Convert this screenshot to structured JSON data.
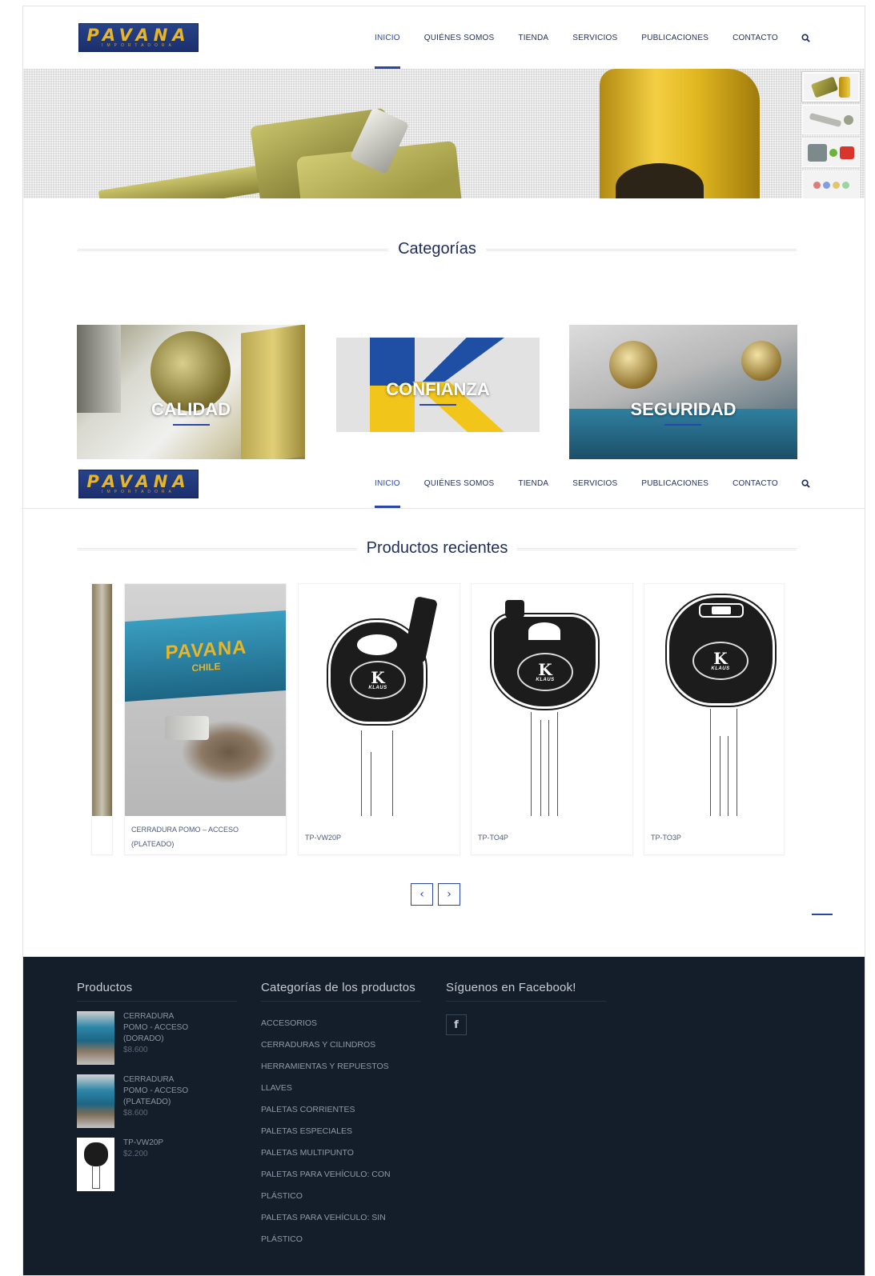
{
  "brand": {
    "name": "PAVANA",
    "tagline": "IMPORTADORA"
  },
  "nav": {
    "items": [
      {
        "label": "INICIO",
        "active": true
      },
      {
        "label": "QUIÉNES SOMOS"
      },
      {
        "label": "TIENDA"
      },
      {
        "label": "SERVICIOS"
      },
      {
        "label": "PUBLICACIONES"
      },
      {
        "label": "CONTACTO"
      }
    ],
    "search_icon": "search-icon"
  },
  "hero": {
    "thumbnail_count": 4,
    "active_thumbnail": 1
  },
  "categories_section": {
    "title": "Categorías",
    "items": [
      {
        "label": "CALIDAD"
      },
      {
        "label": "CONFIANZA"
      },
      {
        "label": "SEGURIDAD"
      }
    ]
  },
  "products_section": {
    "title": "Productos recientes",
    "items": [
      {
        "name": "CERRADURA POMO – ACCESO (PLATEADO)",
        "box_text": "PAVANA",
        "box_sub": "CHILE"
      },
      {
        "name": "TP-VW20P",
        "logo_text": "KLAUS"
      },
      {
        "name": "TP-TO4P",
        "logo_text": "KLAUS"
      },
      {
        "name": "TP-TO3P",
        "logo_text": "KLAUS"
      }
    ],
    "prev_icon": "chevron-left-icon",
    "next_icon": "chevron-right-icon"
  },
  "footer": {
    "products": {
      "title": "Productos",
      "items": [
        {
          "name": "CERRADURA POMO - ACCESO (DORADO)",
          "price": "$8.600"
        },
        {
          "name": "CERRADURA POMO - ACCESO (PLATEADO)",
          "price": "$8.600"
        },
        {
          "name": "TP-VW20P",
          "price": "$2.200"
        }
      ]
    },
    "categories": {
      "title": "Categorías de los productos",
      "items": [
        "ACCESORIOS",
        "CERRADURAS Y CILINDROS",
        "HERRAMIENTAS Y REPUESTOS",
        "LLAVES",
        "PALETAS CORRIENTES",
        "PALETAS ESPECIALES",
        "PALETAS MULTIPUNTO",
        "PALETAS PARA VEHÍCULO: CON PLÁSTICO",
        "PALETAS PARA VEHÍCULO: SIN PLÁSTICO"
      ]
    },
    "facebook": {
      "title": "Síguenos en Facebook!",
      "icon": "facebook-icon",
      "glyph": "f"
    }
  },
  "colors": {
    "accent": "#2a47a8",
    "nav_text": "#1f2d5a",
    "footer_bg": "#141e2a",
    "logo_bg": "#1c2f6d",
    "logo_text": "#e6b628"
  }
}
